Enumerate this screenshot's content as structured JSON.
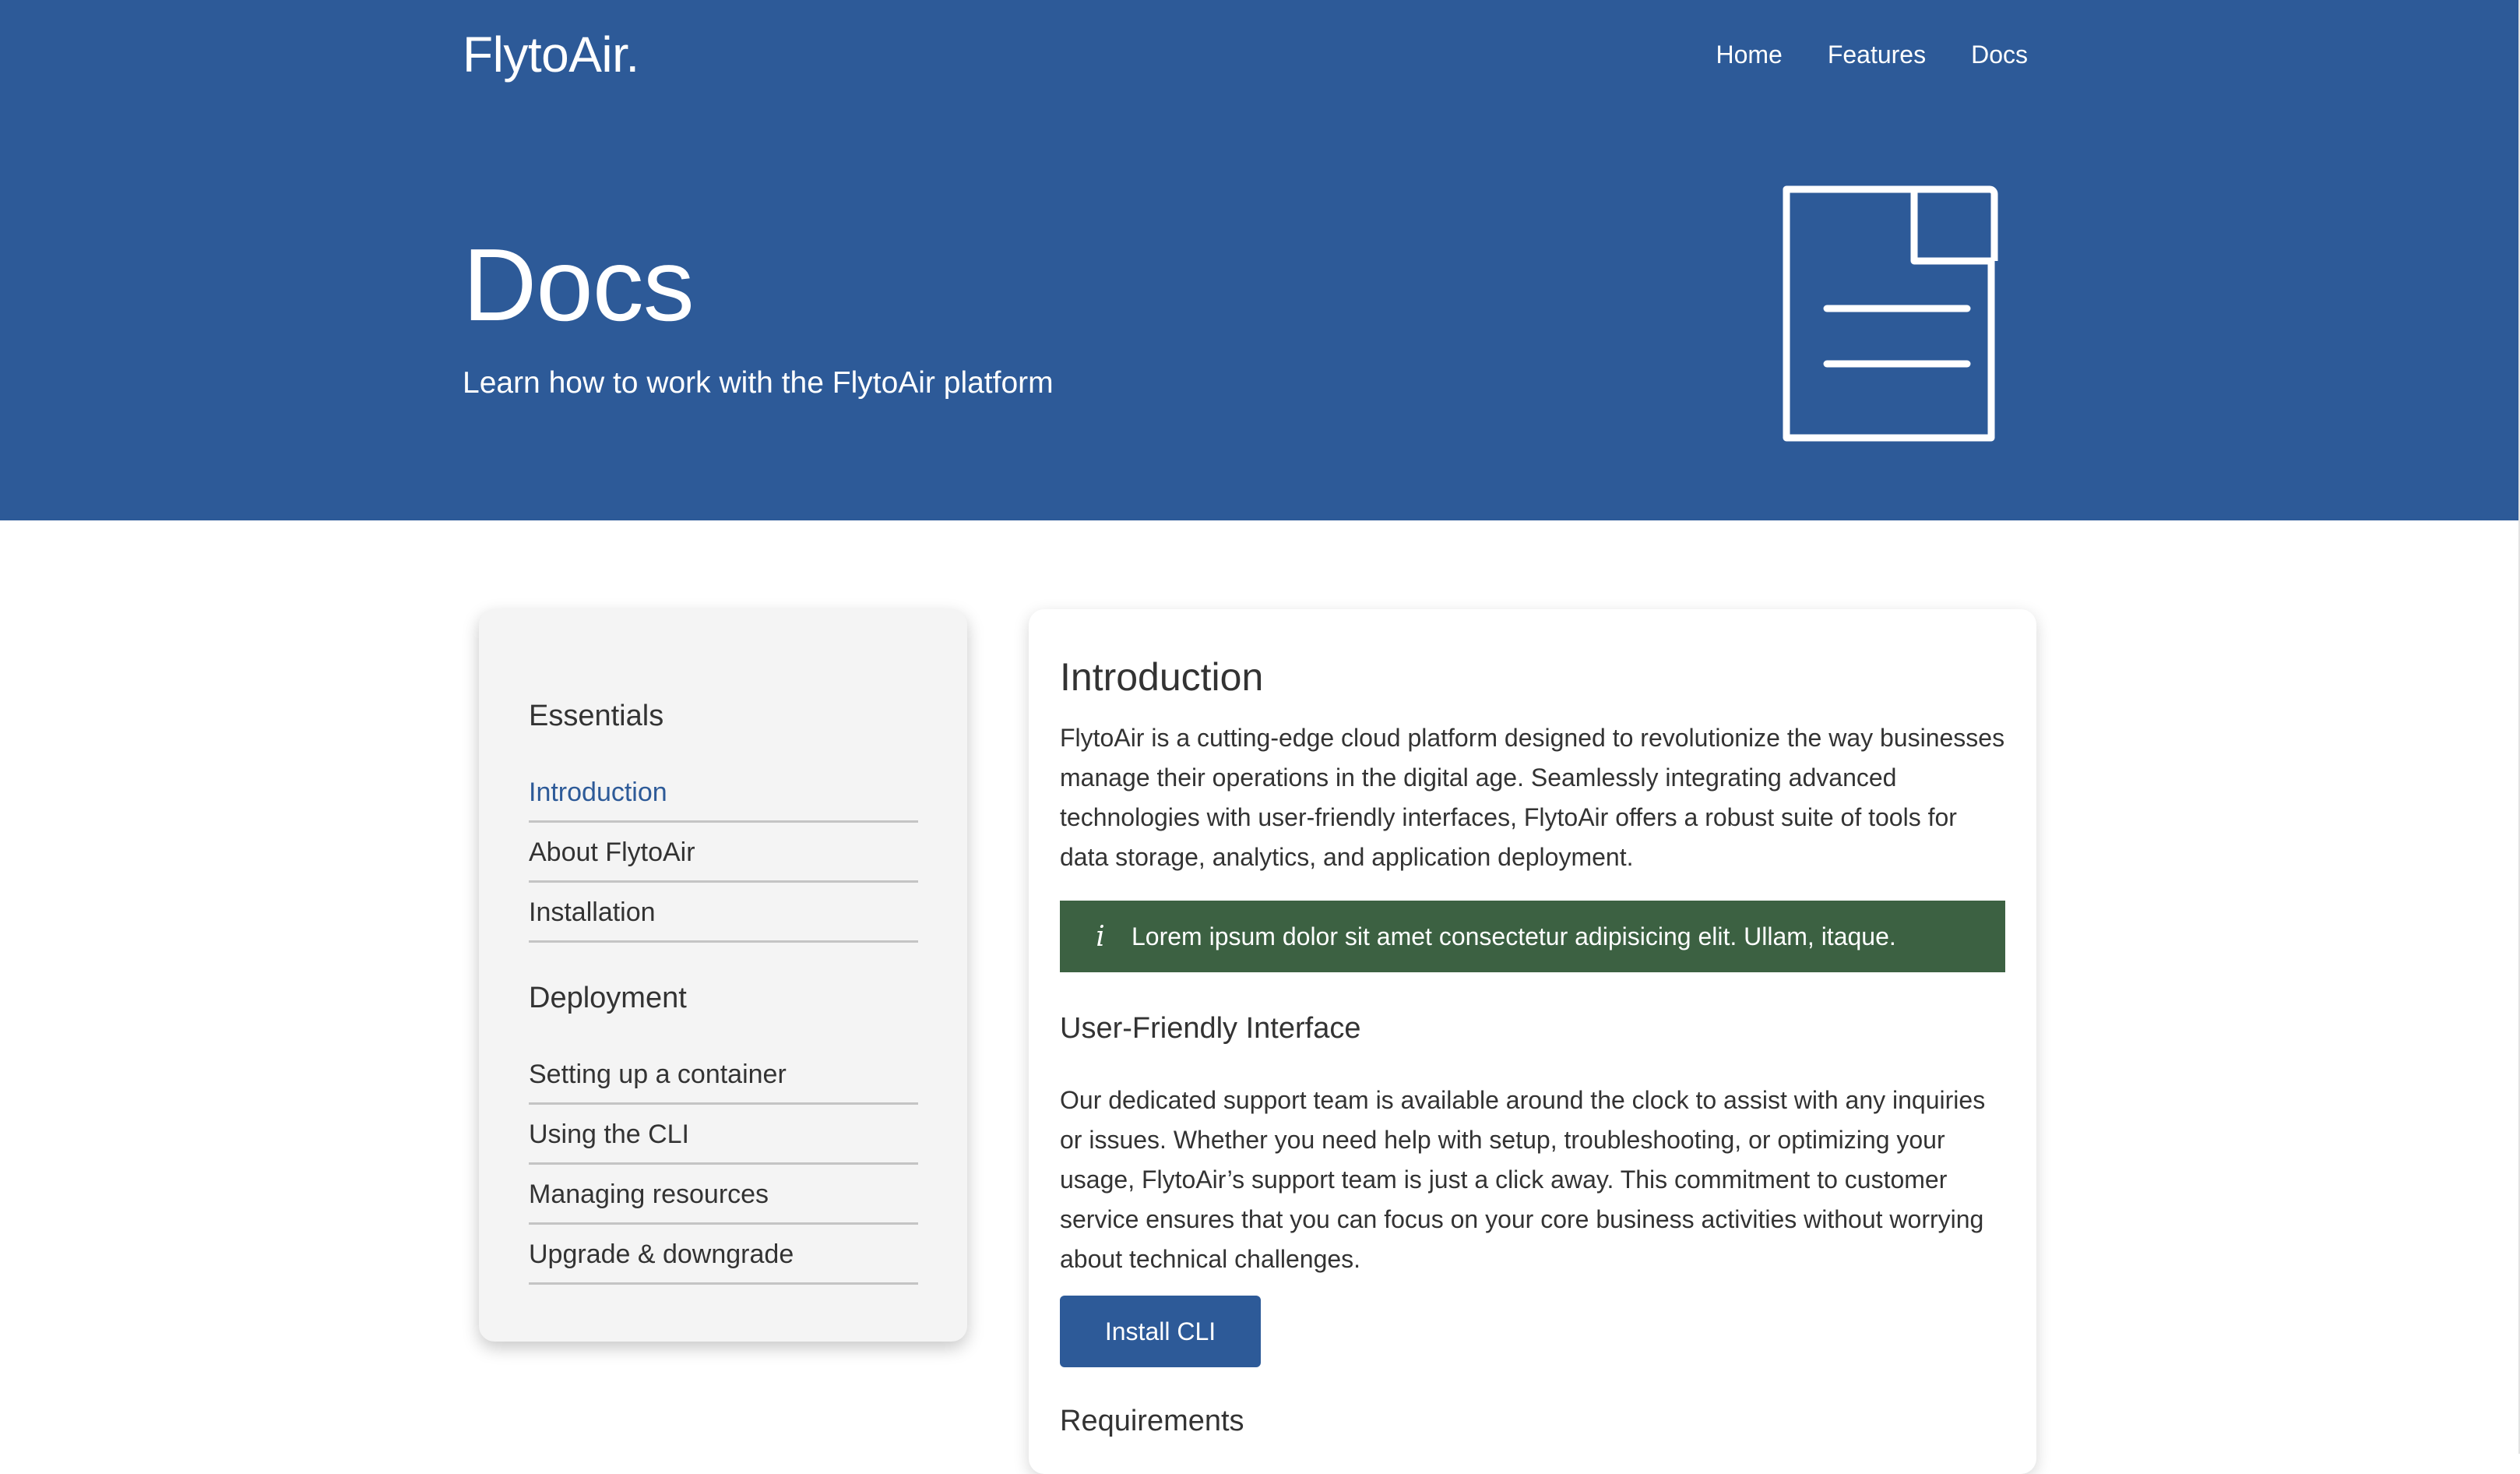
{
  "brand": {
    "logo": "FlytoAir.",
    "primary_color": "#2d5a98",
    "callout_color": "#3c6142"
  },
  "nav": {
    "items": [
      "Home",
      "Features",
      "Docs"
    ]
  },
  "hero": {
    "title": "Docs",
    "subtitle": "Learn how to work with the FlytoAir platform",
    "icon": "document-icon"
  },
  "sidebar": {
    "sections": [
      {
        "heading": "Essentials",
        "items": [
          "Introduction",
          "About FlytoAir",
          "Installation"
        ]
      },
      {
        "heading": "Deployment",
        "items": [
          "Setting up a container",
          "Using the CLI",
          "Managing resources",
          "Upgrade & downgrade"
        ]
      }
    ],
    "active_item": "Introduction"
  },
  "content": {
    "intro_title": "Introduction",
    "intro_text": "FlytoAir is a cutting-edge cloud platform designed to revolutionize the way businesses manage their operations in the digital age. Seamlessly integrating advanced technologies with user-friendly interfaces, FlytoAir offers a robust suite of tools for data storage, analytics, and application deployment.",
    "callout": {
      "icon": "info-icon",
      "glyph": "i",
      "text": "Lorem ipsum dolor sit amet consectetur adipisicing elit. Ullam, itaque."
    },
    "section_title": "User-Friendly Interface",
    "section_text": "Our dedicated support team is available around the clock to assist with any inquiries or issues. Whether you need help with setup, troubleshooting, or optimizing your usage, FlytoAir’s support team is just a click away. This commitment to customer service ensures that you can focus on your core business activities without worrying about technical challenges.",
    "button_label": "Install CLI",
    "requirements_title": "Requirements"
  }
}
